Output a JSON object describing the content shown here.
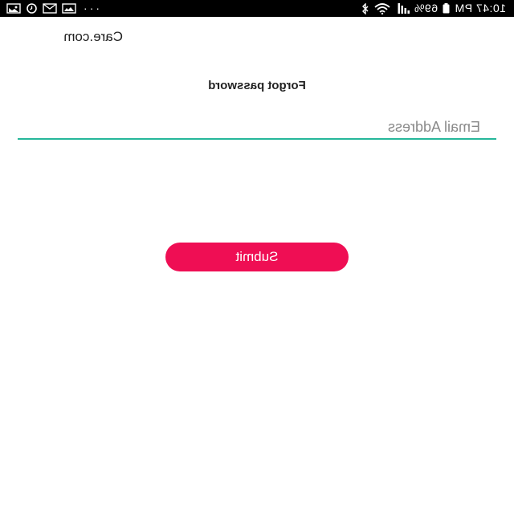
{
  "status_bar": {
    "time": "10:47 PM",
    "battery_percent": "69%",
    "overflow": "···",
    "icons": [
      "battery-icon",
      "signal-icon",
      "wifi-icon",
      "bluetooth-icon",
      "gallery-icon",
      "mail-icon",
      "sync-icon",
      "image-icon"
    ]
  },
  "header": {
    "brand": "Care.com"
  },
  "main": {
    "title": "Forgot password",
    "email": {
      "placeholder": "Email Address",
      "value": ""
    },
    "submit_label": "Submit"
  },
  "colors": {
    "accent": "#ef0e54",
    "input_underline": "#26b79a",
    "status_bar_bg": "#000000"
  }
}
